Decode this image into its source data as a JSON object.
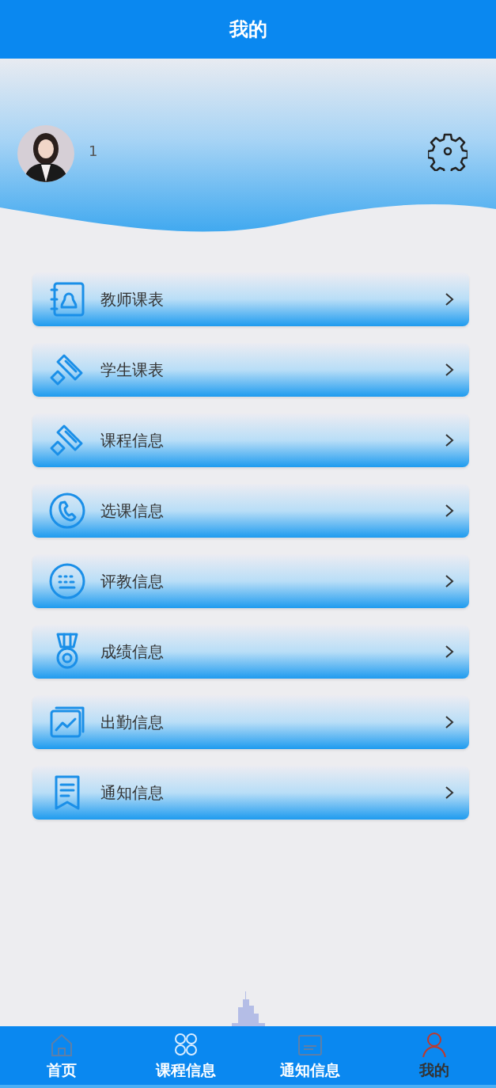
{
  "header": {
    "title": "我的"
  },
  "profile": {
    "username": "1"
  },
  "menu": [
    {
      "label": "教师课表",
      "kind": "contact"
    },
    {
      "label": "学生课表",
      "kind": "stamp"
    },
    {
      "label": "课程信息",
      "kind": "stamp"
    },
    {
      "label": "选课信息",
      "kind": "phone"
    },
    {
      "label": "评教信息",
      "kind": "keyboard"
    },
    {
      "label": "成绩信息",
      "kind": "medal"
    },
    {
      "label": "出勤信息",
      "kind": "chart"
    },
    {
      "label": "通知信息",
      "kind": "note"
    }
  ],
  "tabbar": [
    {
      "label": "首页",
      "kind": "home",
      "selected": false
    },
    {
      "label": "课程信息",
      "kind": "grid",
      "selected": false
    },
    {
      "label": "通知信息",
      "kind": "board",
      "selected": false
    },
    {
      "label": "我的",
      "kind": "user",
      "selected": true
    }
  ]
}
